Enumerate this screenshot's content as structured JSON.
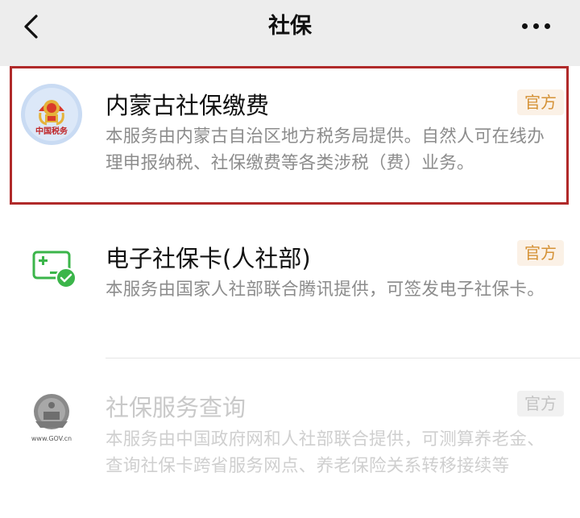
{
  "navbar": {
    "title": "社保",
    "back_icon": "chevron-left-icon",
    "more_icon": "more-dots-icon"
  },
  "results": [
    {
      "title": "内蒙古社保缴费",
      "badge": "官方",
      "description": "本服务由内蒙古自治区地方税务局提供。自然人可在线办理申报纳税、社保缴费等各类涉税（费）业务。",
      "logo_text": "中国税务",
      "logo_icon": "china-tax-emblem-icon",
      "highlighted": true,
      "enabled": true
    },
    {
      "title": "电子社保卡(人社部)",
      "badge": "官方",
      "description": "本服务由国家人社部联合腾讯提供，可签发电子社保卡。",
      "logo_icon": "social-security-card-icon",
      "enabled": true
    },
    {
      "title": "社保服务查询",
      "badge": "官方",
      "description": "本服务由中国政府网和人社部联合提供，可测算养老金、查询社保卡跨省服务网点、养老保险关系转移接续等",
      "logo_text": "www.GOV.cn",
      "logo_icon": "national-emblem-icon",
      "enabled": false
    }
  ],
  "colors": {
    "highlight_border": "#b02a2a",
    "badge_text": "#d59236",
    "badge_bg": "#fbf1e6",
    "wechat_green": "#3bb54a"
  }
}
